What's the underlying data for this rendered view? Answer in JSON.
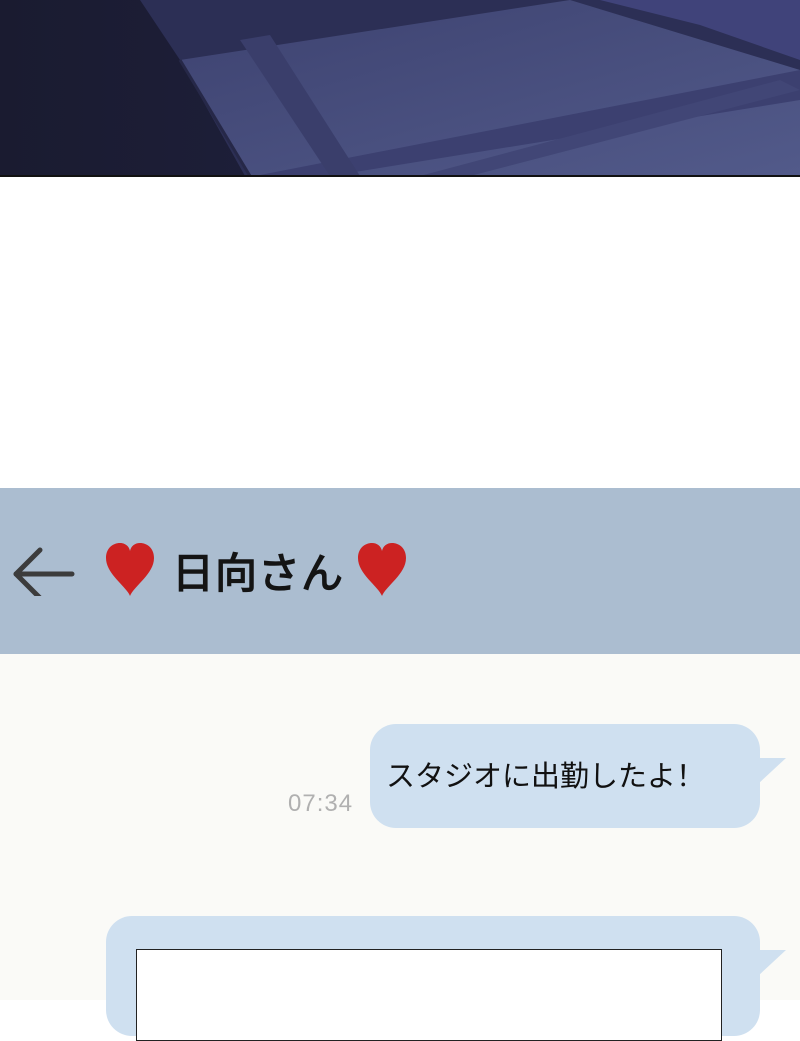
{
  "header": {
    "back_icon": "arrow-left-icon",
    "heart_icon": "heart-icon",
    "contact_name": "日向さん"
  },
  "messages": [
    {
      "direction": "sent",
      "text": "スタジオに出勤したよ！",
      "time": "07:34"
    },
    {
      "direction": "sent",
      "type": "image"
    }
  ],
  "colors": {
    "header_bg": "#abbdd0",
    "chat_bg": "#fafaf7",
    "bubble_bg": "#cfe0f0",
    "heart": "#cc2222",
    "timestamp": "#b0b0b0"
  }
}
